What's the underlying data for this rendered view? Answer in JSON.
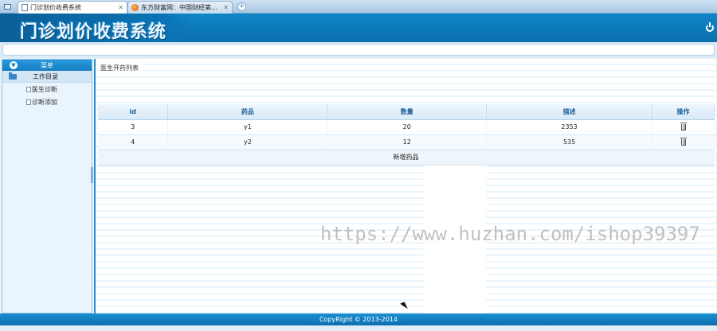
{
  "browser": {
    "tabs": [
      {
        "title": "门诊划价收费系统",
        "active": true
      },
      {
        "title": "东方财富网：中国财经第...",
        "active": false
      }
    ]
  },
  "header": {
    "logo": "门诊划价收费系统"
  },
  "sidebar": {
    "menu_title": "菜单",
    "group_label": "工作目录",
    "items": [
      {
        "label": "医生诊断"
      },
      {
        "label": "诊断添加"
      }
    ]
  },
  "main": {
    "breadcrumb": "医生开药列表",
    "table": {
      "headers": [
        "id",
        "药品",
        "数量",
        "描述",
        "操作"
      ],
      "rows": [
        {
          "id": "3",
          "drug": "y1",
          "qty": "20",
          "desc": "2353"
        },
        {
          "id": "4",
          "drug": "y2",
          "qty": "12",
          "desc": "535"
        }
      ],
      "add_label": "新增药品"
    }
  },
  "watermark": "https://www.huzhan.com/ishop39397",
  "footer": {
    "copyright": "CopyRight © 2013-2014"
  },
  "colors": {
    "header": "#0f86c6",
    "accent": "#2a8fd3"
  }
}
